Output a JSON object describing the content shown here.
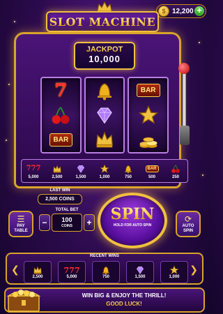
{
  "header": {
    "coins": "12,200",
    "add_icon": "plus-icon",
    "coin_icon": "coin-icon"
  },
  "title": "SLOT MACHINE",
  "jackpot": {
    "label": "JACKPOT",
    "value": "10,000"
  },
  "reels": [
    [
      "seven",
      "cherries",
      "bar"
    ],
    [
      "bell",
      "diamond",
      "crown"
    ],
    [
      "bar",
      "star",
      "coins"
    ]
  ],
  "symbol_text": {
    "seven": "7",
    "bar": "BAR"
  },
  "paytable": [
    {
      "symbol": "777",
      "value": "5,000"
    },
    {
      "symbol": "crown",
      "value": "2,500"
    },
    {
      "symbol": "diamond",
      "value": "1,500"
    },
    {
      "symbol": "star",
      "value": "1,000"
    },
    {
      "symbol": "bell",
      "value": "750"
    },
    {
      "symbol": "BAR",
      "value": "500"
    },
    {
      "symbol": "cherries",
      "value": "250"
    }
  ],
  "controls": {
    "last_win_label": "LAST WIN",
    "last_win_value": "2,500 COINS",
    "pay_table_label": "PAY TABLE",
    "total_bet_label": "TOTAL BET",
    "bet_value": "100",
    "bet_unit": "COINS",
    "minus": "−",
    "plus": "+",
    "spin_label": "SPIN",
    "spin_sub": "HOLD FOR AUTO SPIN",
    "auto_spin_label": "AUTO SPIN"
  },
  "recent_wins": {
    "label": "RECENT WINS",
    "items": [
      {
        "symbol": "crown",
        "value": "2,500"
      },
      {
        "symbol": "777",
        "value": "5,000"
      },
      {
        "symbol": "bell",
        "value": "750"
      },
      {
        "symbol": "diamond",
        "value": "1,500"
      },
      {
        "symbol": "star",
        "value": "1,000"
      }
    ]
  },
  "banner": {
    "line1": "WIN BIG & ENJOY THE THRILL!",
    "line2": "GOOD LUCK!"
  },
  "colors": {
    "gold": "#f0c040",
    "purple": "#5a0fa0",
    "red": "#ff3030"
  }
}
